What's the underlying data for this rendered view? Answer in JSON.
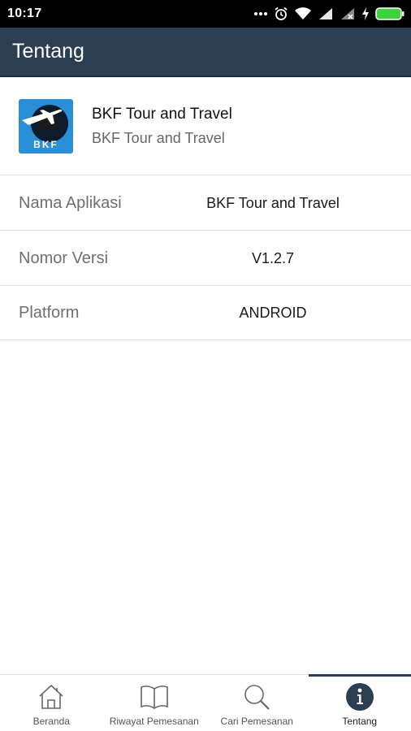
{
  "status_bar": {
    "time": "10:17"
  },
  "app_bar": {
    "title": "Tentang"
  },
  "app_header": {
    "logo_text": "BKF",
    "app_name": "BKF Tour and Travel",
    "app_subtitle": "BKF Tour and Travel"
  },
  "info": [
    {
      "label": "Nama Aplikasi",
      "value": "BKF Tour and Travel"
    },
    {
      "label": "Nomor Versi",
      "value": "V1.2.7"
    },
    {
      "label": "Platform",
      "value": "ANDROID"
    }
  ],
  "bottom_nav": [
    {
      "label": "Beranda",
      "icon": "home-icon",
      "active": false
    },
    {
      "label": "Riwayat Pemesanan",
      "icon": "book-icon",
      "active": false
    },
    {
      "label": "Cari Pemesanan",
      "icon": "search-icon",
      "active": false
    },
    {
      "label": "Tentang",
      "icon": "info-icon",
      "active": true
    }
  ],
  "colors": {
    "app_bar": "#2c3e52",
    "logo_background": "#2a8fd6",
    "battery": "#3fd13f"
  }
}
